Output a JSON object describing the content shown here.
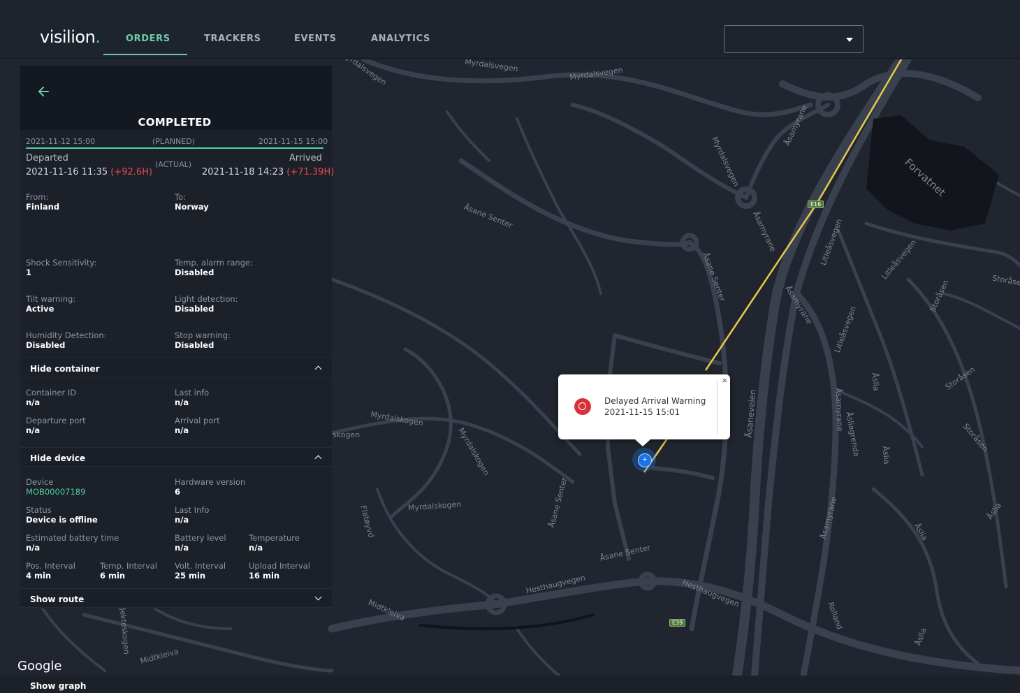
{
  "brand": {
    "logo_text": "visilion",
    "logo_dot": "."
  },
  "nav": {
    "tabs": [
      {
        "label": "ORDERS",
        "active": true
      },
      {
        "label": "TRACKERS"
      },
      {
        "label": "EVENTS"
      },
      {
        "label": "ANALYTICS"
      }
    ],
    "select": {
      "value": "",
      "icon": "chevron-down-icon"
    }
  },
  "order": {
    "status": "COMPLETED",
    "planned": {
      "label": "(PLANNED)",
      "departure": "2021-11-12 15:00",
      "arrival": "2021-11-15 15:00"
    },
    "actual": {
      "label": "(ACTUAL)",
      "departed_label": "Departed",
      "departed": "2021-11-16 11:35",
      "departed_delay": "(+92.6H)",
      "arrived_label": "Arrived",
      "arrived": "2021-11-18 14:23",
      "arrived_delay": "(+71.39H)"
    },
    "from_label": "From:",
    "from": "Finland",
    "to_label": "To:",
    "to": "Norway",
    "settings": [
      {
        "label": "Shock Sensitivity:",
        "value": "1"
      },
      {
        "label": "Temp. alarm range:",
        "value": "Disabled"
      },
      {
        "label": "Tilt warning:",
        "value": "Active"
      },
      {
        "label": "Light detection:",
        "value": "Disabled"
      },
      {
        "label": "Humidity Detection:",
        "value": "Disabled"
      },
      {
        "label": "Stop warning:",
        "value": "Disabled"
      }
    ]
  },
  "container": {
    "toggle_label": "Hide container",
    "fields": [
      {
        "label": "Container ID",
        "value": "n/a"
      },
      {
        "label": "Last info",
        "value": "n/a"
      },
      {
        "label": "Departure port",
        "value": "n/a"
      },
      {
        "label": "Arrival port",
        "value": "n/a"
      }
    ]
  },
  "device": {
    "toggle_label": "Hide device",
    "fields": [
      {
        "label": "Device",
        "value": "MOB00007189"
      },
      {
        "label": "Hardware version",
        "value": "6"
      },
      {
        "label": "Status",
        "value": "Device is offline"
      },
      {
        "label": "Last Info",
        "value": "n/a"
      },
      {
        "label": "Estimated battery time",
        "value": "n/a"
      },
      {
        "label": "Battery level",
        "value": "n/a"
      },
      {
        "label": "Temperature",
        "value": "n/a"
      },
      {
        "label": "Pos. Interval",
        "value": "4 min"
      },
      {
        "label": "Temp. Interval",
        "value": "6 min"
      },
      {
        "label": "Volt. Interval",
        "value": "25 min"
      },
      {
        "label": "Upload Interval",
        "value": "16 min"
      }
    ]
  },
  "route": {
    "toggle_label": "Show route"
  },
  "graph": {
    "toggle_label": "Show graph"
  },
  "popup": {
    "title": "Delayed Arrival Warning",
    "time": "2021-11-15 15:01",
    "close": "×"
  },
  "map": {
    "attribution": "Google",
    "labels": [
      "Myrdalsvegen",
      "Myrdalsvegen",
      "Myrdalsvegen",
      "Åsane Senter",
      "Myrdalsvegen",
      "Åsamyrane",
      "Åsamyrane",
      "Åsamyrane",
      "Forvatnet",
      "Litleåsvegen",
      "Litleåsvegen",
      "Storåsen",
      "Storåsen",
      "Storåsen",
      "Åsane Senter",
      "Myrdalskogen",
      "Myrdalskogen",
      "Myrdalskogen",
      "Flatøyvd",
      "Åsane Senter",
      "Åsane Senter",
      "Hesthaugvegen",
      "Hesthaugvegen",
      "Midtkleiva",
      "Midtkleiva",
      "Åsaneveien",
      "Åsamyrane",
      "Åsamyrane",
      "Åslia",
      "Åslia",
      "Åslia",
      "Åslia",
      "skogen",
      "Litleåsvegen",
      "Storåse",
      "Åsliagrenda",
      "Rolland",
      "Åslia",
      "Jekteskogen"
    ],
    "shields": [
      "E16",
      "E39"
    ],
    "colors": {
      "route": "#e6c84a",
      "marker": "#1a73e8",
      "background": "#20252f"
    }
  }
}
